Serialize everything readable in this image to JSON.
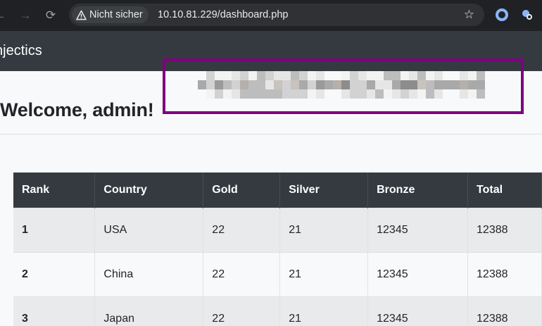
{
  "browser": {
    "security_label": "Nicht sicher",
    "url": "10.10.81.229/dashboard.php",
    "back_icon": "←",
    "forward_icon": "→",
    "reload_icon": "⟳",
    "star_icon": "☆"
  },
  "navbar": {
    "brand": "njectics"
  },
  "page": {
    "welcome": "Welcome, admin!"
  },
  "table": {
    "headers": [
      "Rank",
      "Country",
      "Gold",
      "Silver",
      "Bronze",
      "Total"
    ],
    "rows": [
      [
        "1",
        "USA",
        "22",
        "21",
        "12345",
        "12388"
      ],
      [
        "2",
        "China",
        "22",
        "21",
        "12345",
        "12388"
      ],
      [
        "3",
        "Japan",
        "22",
        "21",
        "12345",
        "12388"
      ]
    ]
  },
  "colors": {
    "navbar": "#343a40",
    "redaction_border": "#800080",
    "browser_bg": "#202124"
  }
}
